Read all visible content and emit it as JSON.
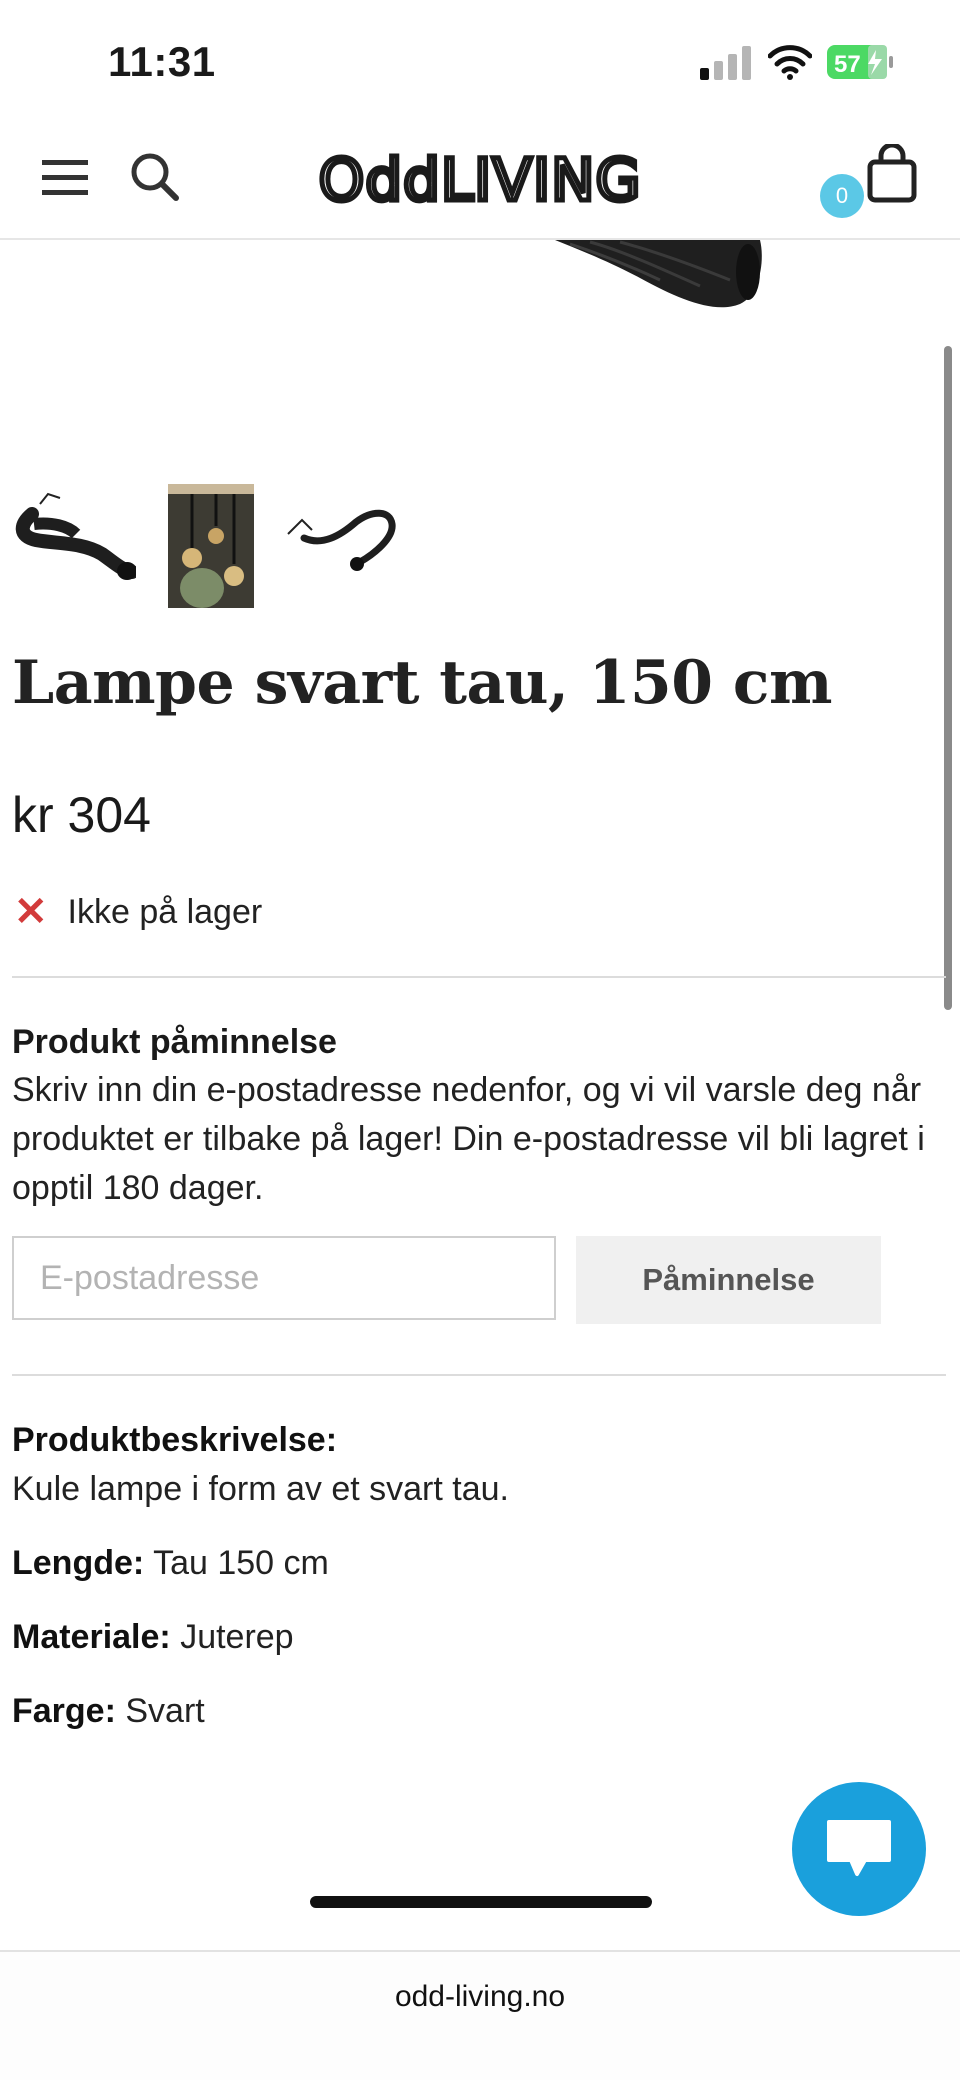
{
  "status_bar": {
    "time": "11:31",
    "battery_level": "57",
    "battery_color": "#4cd964"
  },
  "header": {
    "logo_text": "OddLIVING",
    "cart_count": "0",
    "badge_color": "#5bc8e6"
  },
  "product": {
    "title": "Lampe svart tau, 150 cm",
    "price": "kr 304",
    "stock_status": "Ikke på lager",
    "stock_icon": "x-icon"
  },
  "reminder": {
    "heading": "Produkt påminnelse",
    "text": "Skriv inn din e-postadresse nedenfor, og vi vil varsle deg når produktet er tilbake på lager! Din e-postadresse vil bli lagret i opptil 180 dager.",
    "email_placeholder": "E-postadresse",
    "email_value": "",
    "button_label": "Påminnelse"
  },
  "description": {
    "heading": "Produktbeskrivelse:",
    "text": "Kule lampe i form av et svart tau.",
    "specs": [
      {
        "label": "Lengde:",
        "value": "Tau 150 cm"
      },
      {
        "label": "Materiale:",
        "value": "Juterep"
      },
      {
        "label": "Farge:",
        "value": "Svart"
      }
    ]
  },
  "chat": {
    "icon": "chat-icon",
    "color": "#1aa0dc"
  },
  "browser": {
    "domain": "odd-living.no"
  }
}
